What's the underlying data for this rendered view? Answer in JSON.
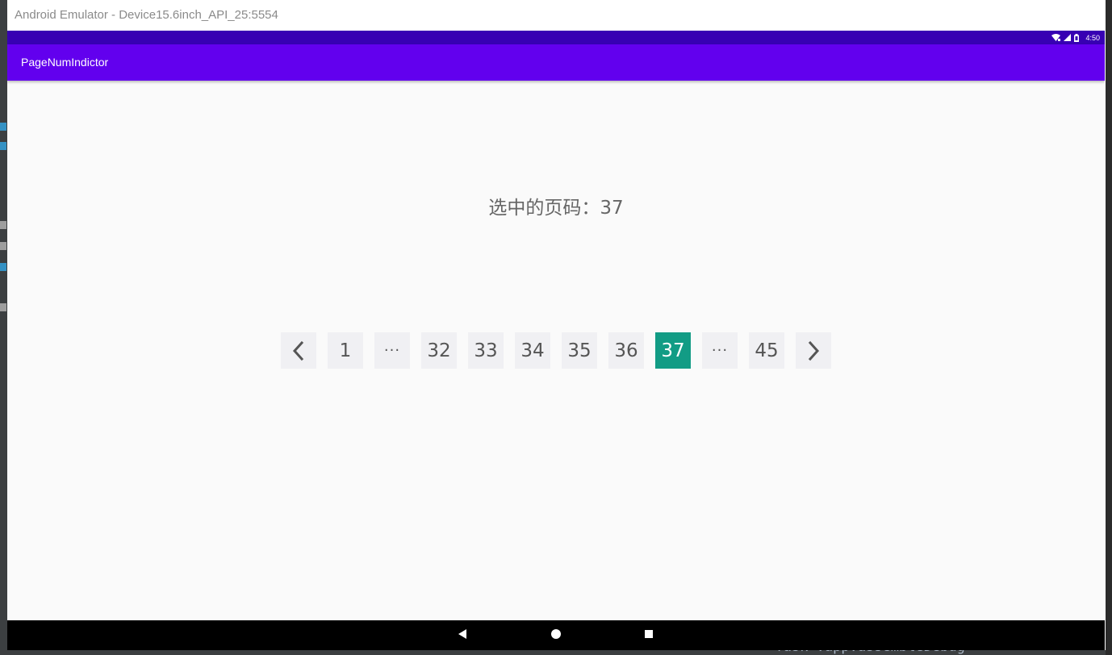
{
  "window": {
    "title": "Android Emulator - Device15.6inch_API_25:5554"
  },
  "status_bar": {
    "time": "4:50",
    "icons": [
      "wifi-icon",
      "signal-icon",
      "battery-icon"
    ]
  },
  "app_bar": {
    "title": "PageNumIndictor"
  },
  "main": {
    "selected_label": "选中的页码：37"
  },
  "pager": {
    "prev_icon": "chevron-left-icon",
    "next_icon": "chevron-right-icon",
    "items": [
      "1",
      "···",
      "32",
      "33",
      "34",
      "35",
      "36",
      "37",
      "···",
      "45"
    ],
    "active": "37",
    "active_color": "#129c85",
    "button_bg": "#f0f0f3"
  },
  "nav_bar": {
    "icons": [
      "back-icon",
      "home-icon",
      "recents-icon"
    ]
  },
  "ide_background": {
    "console_text": "> Task :app:assembleDebug"
  },
  "colors": {
    "status_bar": "#3700b3",
    "app_bar": "#6200ee",
    "screen_bg": "#fafafa"
  }
}
